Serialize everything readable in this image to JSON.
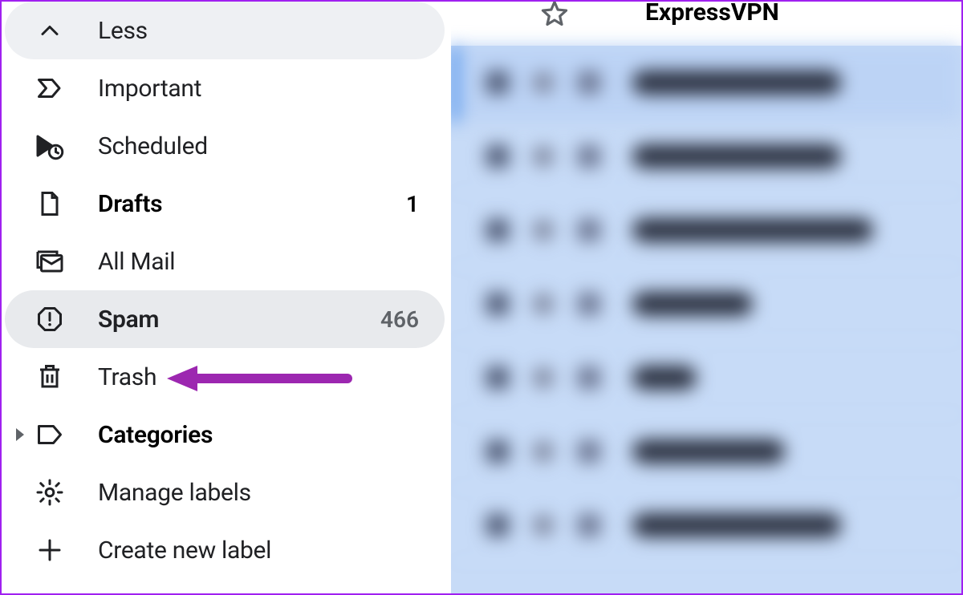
{
  "sidebar": {
    "less": "Less",
    "important": "Important",
    "scheduled": "Scheduled",
    "drafts": {
      "label": "Drafts",
      "count": "1"
    },
    "allmail": "All Mail",
    "spam": {
      "label": "Spam",
      "count": "466"
    },
    "trash": "Trash",
    "categories": "Categories",
    "manage": "Manage labels",
    "create": "Create new label"
  },
  "mail": {
    "top_sender": "ExpressVPN"
  }
}
